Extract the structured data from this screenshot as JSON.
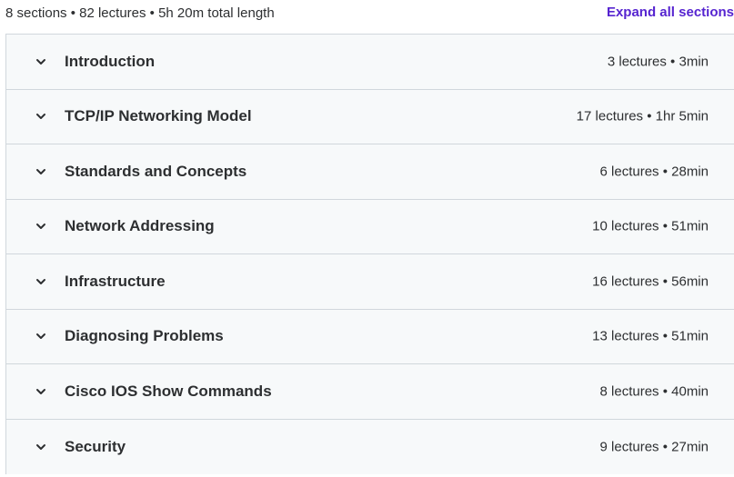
{
  "curriculum": {
    "summary": "8 sections • 82 lectures • 5h 20m total length",
    "expand_all_label": "Expand all sections",
    "accent_color": "#5624d0",
    "sections": [
      {
        "title": "Introduction",
        "meta": "3 lectures • 3min",
        "icon": "chevron-down-icon"
      },
      {
        "title": "TCP/IP Networking Model",
        "meta": "17 lectures • 1hr 5min",
        "icon": "chevron-down-icon"
      },
      {
        "title": "Standards and Concepts",
        "meta": "6 lectures • 28min",
        "icon": "chevron-down-icon"
      },
      {
        "title": "Network Addressing",
        "meta": "10 lectures • 51min",
        "icon": "chevron-down-icon"
      },
      {
        "title": "Infrastructure",
        "meta": "16 lectures • 56min",
        "icon": "chevron-down-icon"
      },
      {
        "title": "Diagnosing Problems",
        "meta": "13 lectures • 51min",
        "icon": "chevron-down-icon"
      },
      {
        "title": "Cisco IOS Show Commands",
        "meta": "8 lectures • 40min",
        "icon": "chevron-down-icon"
      },
      {
        "title": "Security",
        "meta": "9 lectures • 27min",
        "icon": "chevron-down-icon"
      }
    ]
  }
}
